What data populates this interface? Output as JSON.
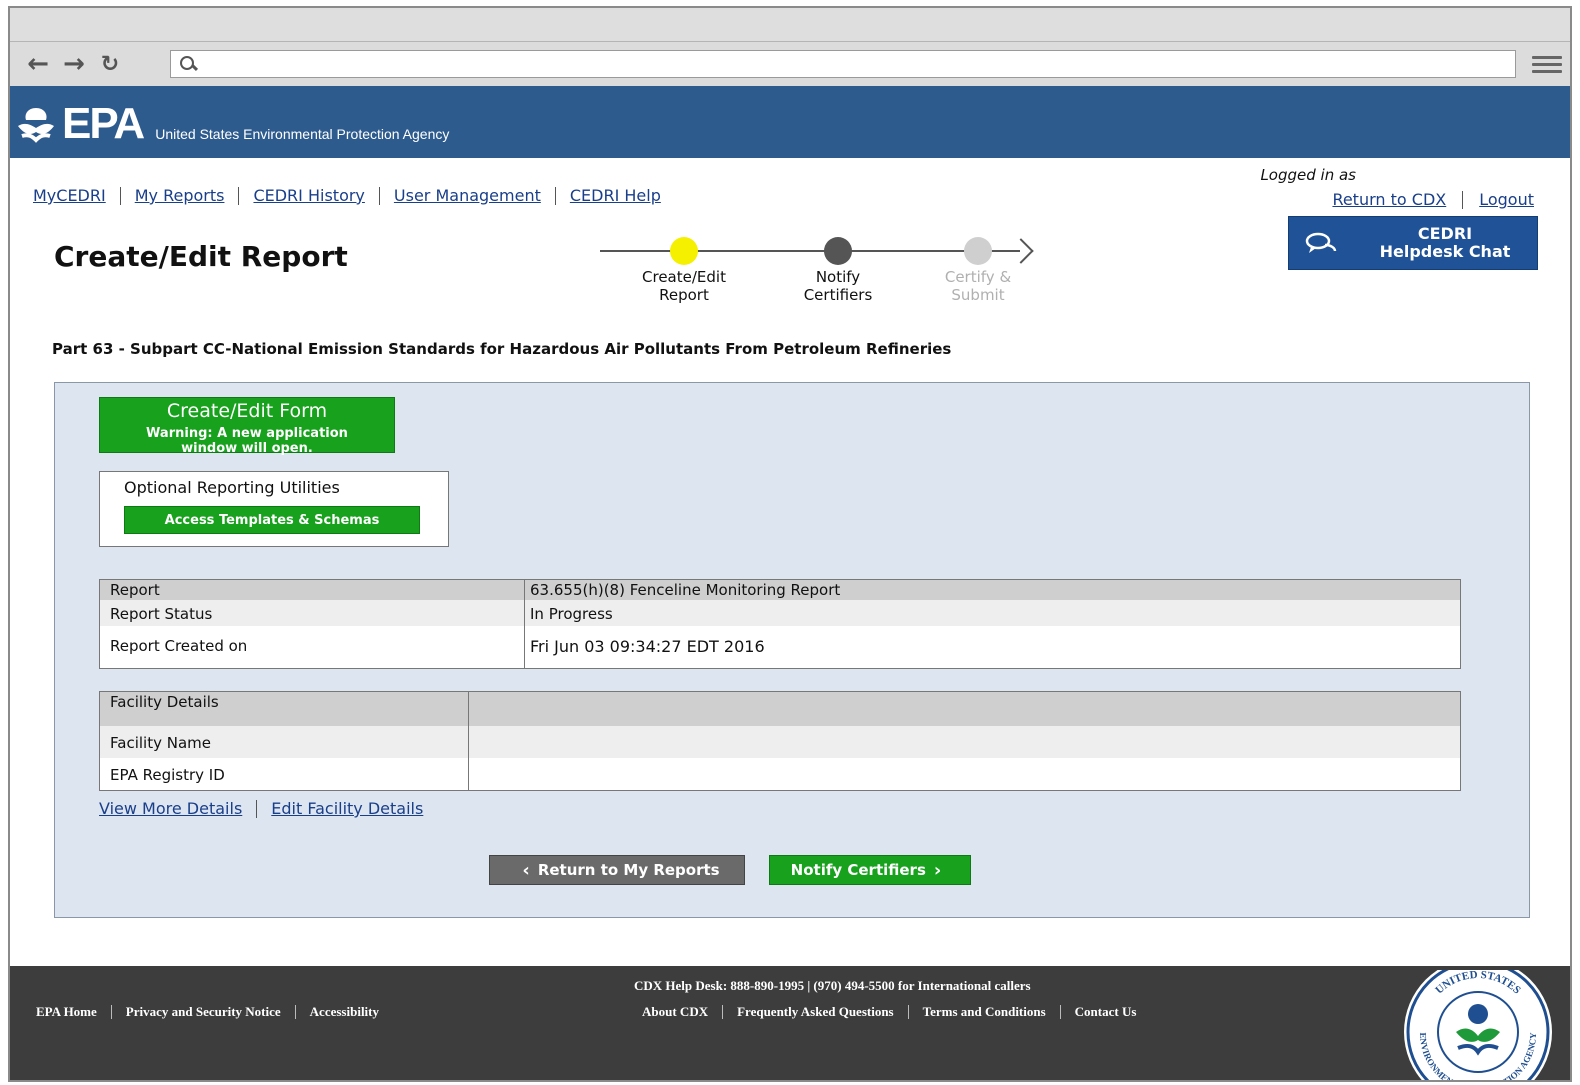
{
  "browser": {
    "url_value": ""
  },
  "header": {
    "logo_text": "EPA",
    "agency_name": "United States Environmental Protection Agency"
  },
  "nav": {
    "items": [
      "MyCEDRI",
      "My Reports",
      "CEDRI History",
      "User Management",
      "CEDRI Help"
    ]
  },
  "account": {
    "logged_in_label": "Logged in as",
    "return_cdx": "Return to CDX",
    "logout": "Logout"
  },
  "chat": {
    "line1": "CEDRI",
    "line2": "Helpdesk Chat"
  },
  "page": {
    "title": "Create/Edit Report",
    "subpart": "Part 63 - Subpart CC-National Emission Standards for Hazardous Air Pollutants From Petroleum Refineries"
  },
  "steps": [
    {
      "line1": "Create/Edit",
      "line2": "Report",
      "state": "current",
      "color": "#f5f000"
    },
    {
      "line1": "Notify",
      "line2": "Certifiers",
      "state": "pending",
      "color": "#555555"
    },
    {
      "line1": "Certify &",
      "line2": "Submit",
      "state": "disabled",
      "color": "#cfcfcf"
    }
  ],
  "form_button": {
    "title": "Create/Edit Form",
    "warning_line1": "Warning: A new application",
    "warning_line2": "window will open."
  },
  "utilities": {
    "title": "Optional Reporting Utilities",
    "button": "Access Templates & Schemas"
  },
  "report_table": {
    "rows": [
      {
        "label": "Report",
        "value": "63.655(h)(8) Fenceline Monitoring Report"
      },
      {
        "label": "Report Status",
        "value": "In Progress"
      },
      {
        "label": "Report Created on",
        "value": "Fri Jun 03 09:34:27 EDT 2016"
      }
    ]
  },
  "facility_table": {
    "header": "Facility Details",
    "rows": [
      {
        "label": "Facility Name",
        "value": ""
      },
      {
        "label": "EPA Registry ID",
        "value": ""
      }
    ]
  },
  "facility_links": {
    "view_more": "View More Details",
    "edit": "Edit Facility Details"
  },
  "actions": {
    "back": "Return to My Reports",
    "next": "Notify Certifiers"
  },
  "footer": {
    "left_links": [
      "EPA Home",
      "Privacy and Security Notice",
      "Accessibility"
    ],
    "helpdesk": "CDX Help Desk: 888-890-1995 | (970) 494-5500 for International callers",
    "mid_links": [
      "About CDX",
      "Frequently Asked Questions",
      "Terms and Conditions",
      "Contact Us"
    ],
    "seal_text_top": "UNITED STATES",
    "seal_text_bottom": "ENVIRONMENTAL PROTECTION AGENCY"
  },
  "colors": {
    "header_blue": "#2e5b8e",
    "action_green": "#17a11d",
    "panel_bg": "#dde5f0",
    "footer_bg": "#3d3d3d"
  }
}
